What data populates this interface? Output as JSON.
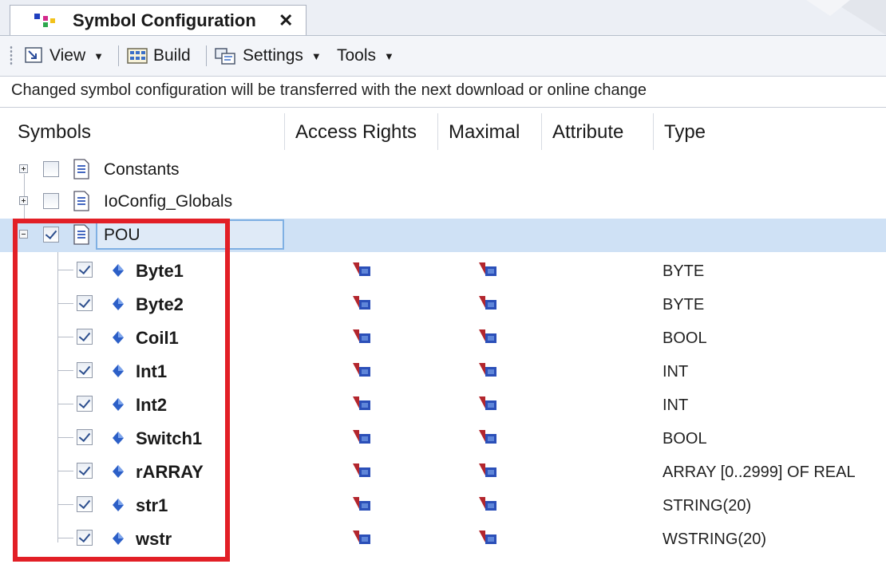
{
  "tab": {
    "title": "Symbol Configuration",
    "close_label": "✕"
  },
  "toolbar": {
    "view_label": "View",
    "build_label": "Build",
    "settings_label": "Settings",
    "tools_label": "Tools"
  },
  "info": {
    "message": "Changed symbol configuration will be transferred with the next download or online change"
  },
  "columns": {
    "symbols": "Symbols",
    "access_rights": "Access Rights",
    "maximal": "Maximal",
    "attribute": "Attribute",
    "type": "Type"
  },
  "tree": {
    "groups": [
      {
        "label": "Constants",
        "expanded": false,
        "checked": false
      },
      {
        "label": "IoConfig_Globals",
        "expanded": false,
        "checked": false
      },
      {
        "label": "POU",
        "expanded": true,
        "checked": true,
        "selected": true
      }
    ],
    "variables": [
      {
        "name": "Byte1",
        "type": "BYTE",
        "checked": true
      },
      {
        "name": "Byte2",
        "type": "BYTE",
        "checked": true
      },
      {
        "name": "Coil1",
        "type": "BOOL",
        "checked": true
      },
      {
        "name": "Int1",
        "type": "INT",
        "checked": true
      },
      {
        "name": "Int2",
        "type": "INT",
        "checked": true
      },
      {
        "name": "Switch1",
        "type": "BOOL",
        "checked": true
      },
      {
        "name": "rARRAY",
        "type": "ARRAY [0..2999] OF REAL",
        "checked": true
      },
      {
        "name": "str1",
        "type": "STRING(20)",
        "checked": true
      },
      {
        "name": "wstr",
        "type": "WSTRING(20)",
        "checked": true
      }
    ]
  },
  "colors": {
    "highlight": "#e21f26",
    "selection": "#cfe1f5",
    "tab_strip": "#eceff5"
  },
  "icons": {
    "tab": "symbol-configuration-icon",
    "view": "view-icon",
    "build": "build-icon",
    "settings": "settings-icon",
    "group": "document-icon",
    "variable": "variable-icon",
    "access": "read-write-access-icon"
  }
}
